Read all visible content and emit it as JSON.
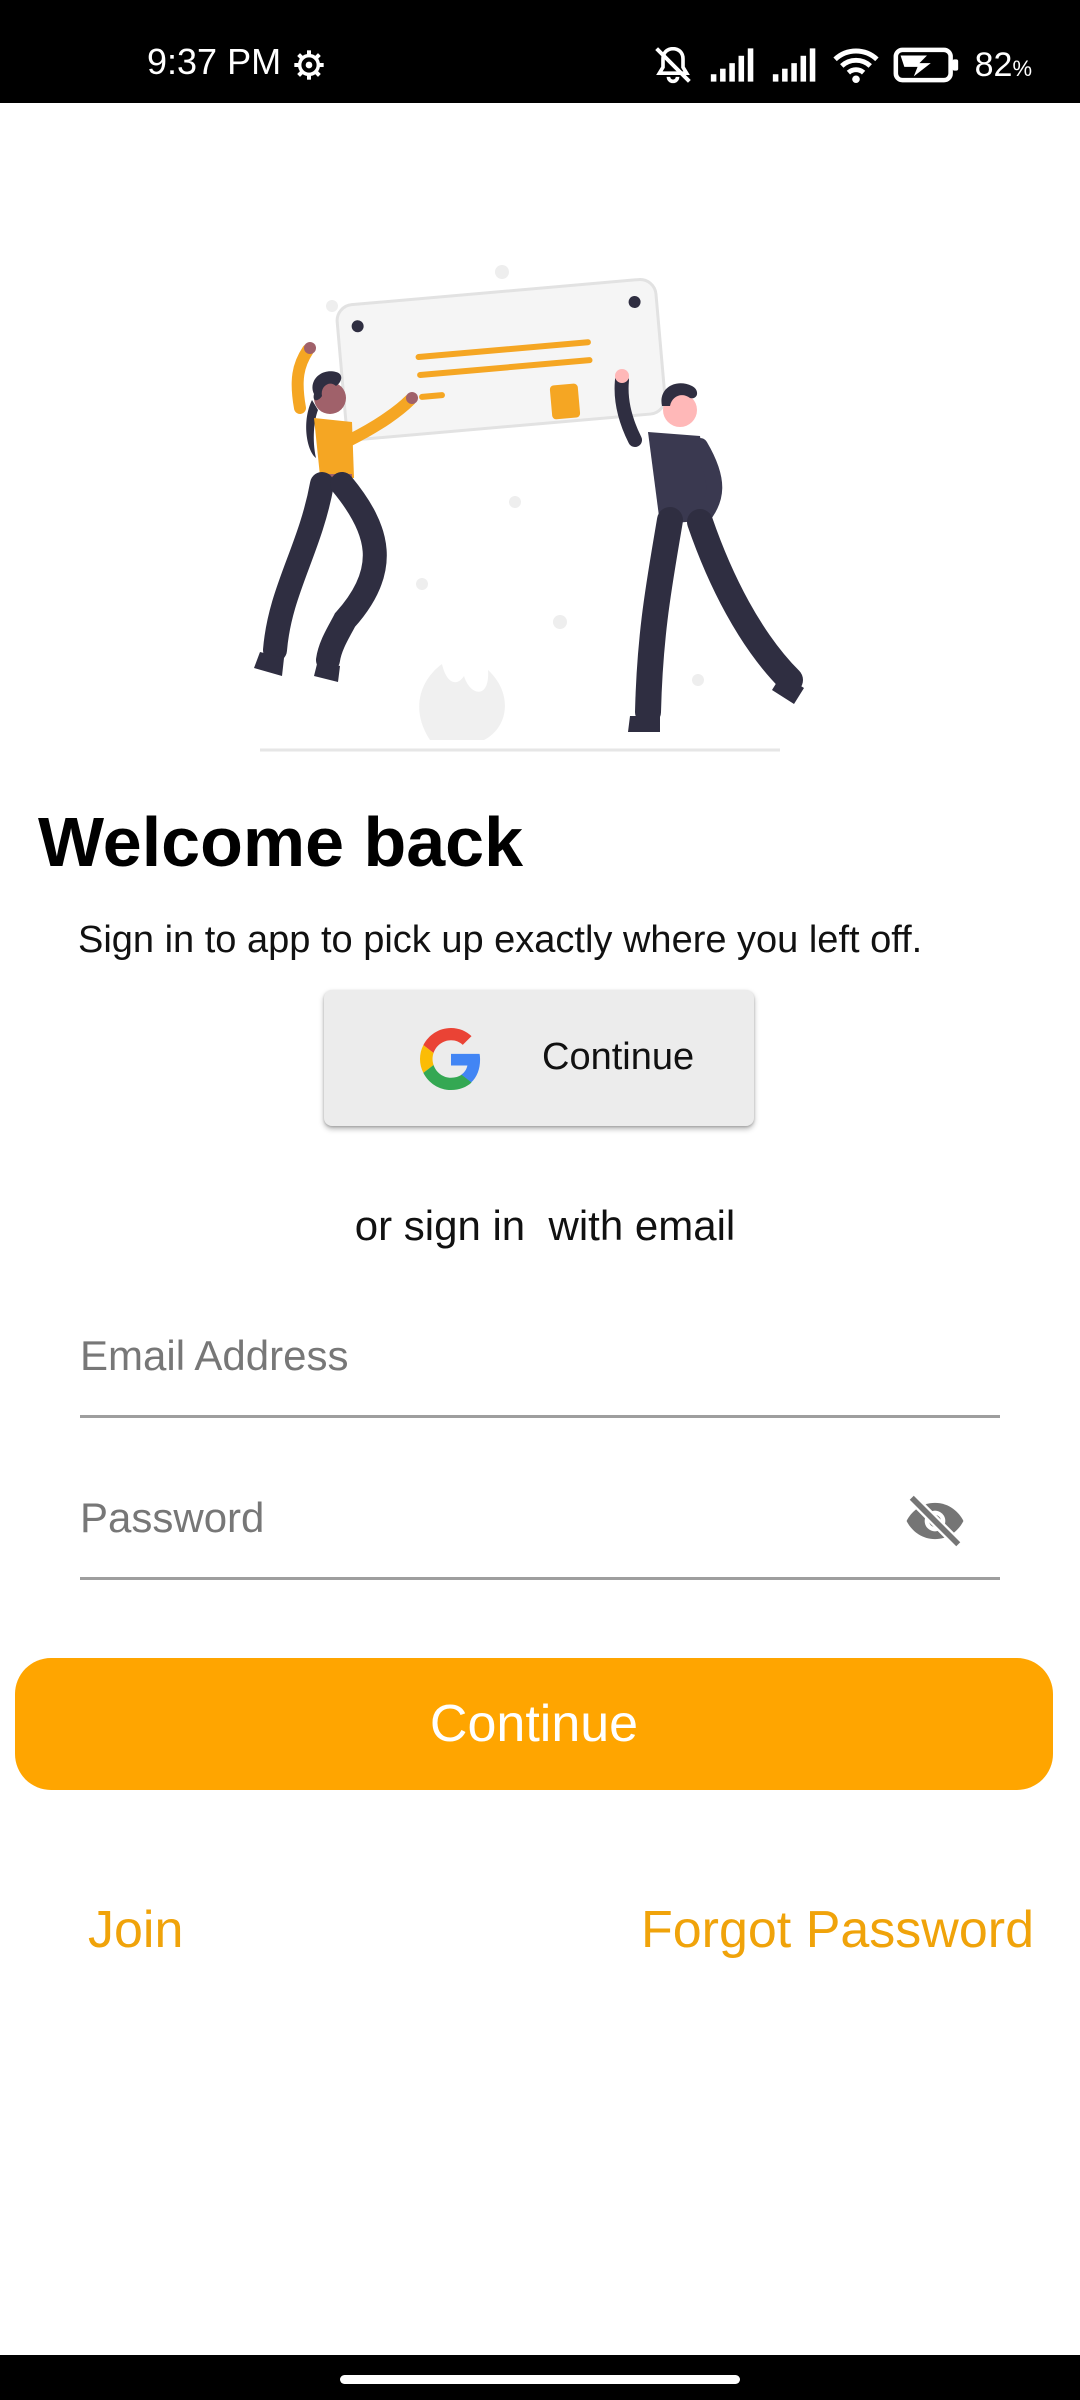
{
  "status_bar": {
    "time": "9:37 PM",
    "battery": "82",
    "battery_unit": "%"
  },
  "welcome": {
    "title": "Welcome back",
    "subtitle": "Sign in to app to pick up exactly where you left off."
  },
  "google": {
    "label": "Continue"
  },
  "divider_text": "or sign in  with email",
  "form": {
    "email_placeholder": "Email Address",
    "email_value": "",
    "password_placeholder": "Password",
    "password_value": ""
  },
  "continue_label": "Continue",
  "links": {
    "join": "Join",
    "forgot": "Forgot Password"
  },
  "colors": {
    "accent": "#ffa500",
    "link": "#f0a30a",
    "illustration_yellow": "#f5a623",
    "illustration_dark": "#2f2e41"
  }
}
